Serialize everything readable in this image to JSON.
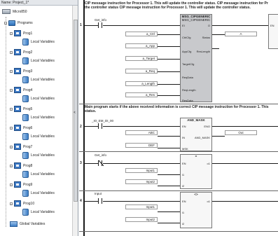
{
  "tree": {
    "title": "Name: Project_1*",
    "scroll_arrow_label": "<",
    "cpu": "Micro850",
    "programs_folder": "Programs",
    "programs": [
      {
        "name": "Prog1",
        "vars": "Local Variables"
      },
      {
        "name": "Prog2",
        "vars": "Local Variables"
      },
      {
        "name": "Prog3",
        "vars": "Local Variables"
      },
      {
        "name": "Prog4",
        "vars": "Local Variables"
      },
      {
        "name": "Prog5",
        "vars": "Local Variables"
      },
      {
        "name": "Prog6",
        "vars": "Local Variables"
      },
      {
        "name": "Prog7",
        "vars": "Local Variables"
      },
      {
        "name": "Prog8",
        "vars": "Local Variables"
      },
      {
        "name": "Prog9",
        "vars": "Local Variables"
      },
      {
        "name": "Prog10",
        "vars": "Local Variables"
      }
    ],
    "global_vars": "Global Variables"
  },
  "editor": {
    "comment1": "CIP message instruction for Processor 1. This will update the controller status. CIP message instruction for Pr",
    "comment1b": "the controller status CIP message instruction for Processor 1. This will update the controller status.",
    "comment2": "Main program starts if the above received information is correct CIP message instruction for Processor 1. This",
    "comment2b": "status.",
    "rungs": [
      "1",
      "2",
      "3",
      "4"
    ],
    "rung1": {
      "contact": "Get_info",
      "block_title": "MSG_CIPGENERIC",
      "block_subtitle": "MSG_CIPGENERIC",
      "pin_ei": "EI",
      "pin_o": "O",
      "pins_left": [
        "CtrlCfg",
        "AppCfg",
        "TargetCfg",
        "ReqData",
        "ReqLength",
        "ResData"
      ],
      "pins_right": [
        "Status",
        "ResLength"
      ],
      "vars": [
        "a_Ctrl",
        "a_App",
        "a_Target",
        "a_Req",
        "a_Length",
        "a_Res"
      ],
      "out_var": "A",
      "right_pin": "EN"
    },
    "rung2": {
      "contact": "_IO_EM_DI_00",
      "block_title": "AND_MASK",
      "pins_left": [
        "EN",
        "IN",
        "MSK"
      ],
      "pins_right": [
        "ENO",
        "AND_MASK"
      ],
      "vars": [
        "ABC",
        "DEF"
      ],
      "out_var": "Out"
    },
    "rung3": {
      "contact": "Get_info",
      "block_title": "=",
      "pins_left": [
        "EN",
        "i1",
        "i2"
      ],
      "pins_right": [
        "o1"
      ],
      "vars": [
        "Input1",
        "Input2"
      ]
    },
    "rung4": {
      "contact": "Input",
      "block_title": "<>",
      "pins_left": [
        "EN",
        "i1",
        "i2"
      ],
      "pins_right": [
        "o1"
      ],
      "vars": [
        "Input1",
        "Input2"
      ]
    }
  }
}
